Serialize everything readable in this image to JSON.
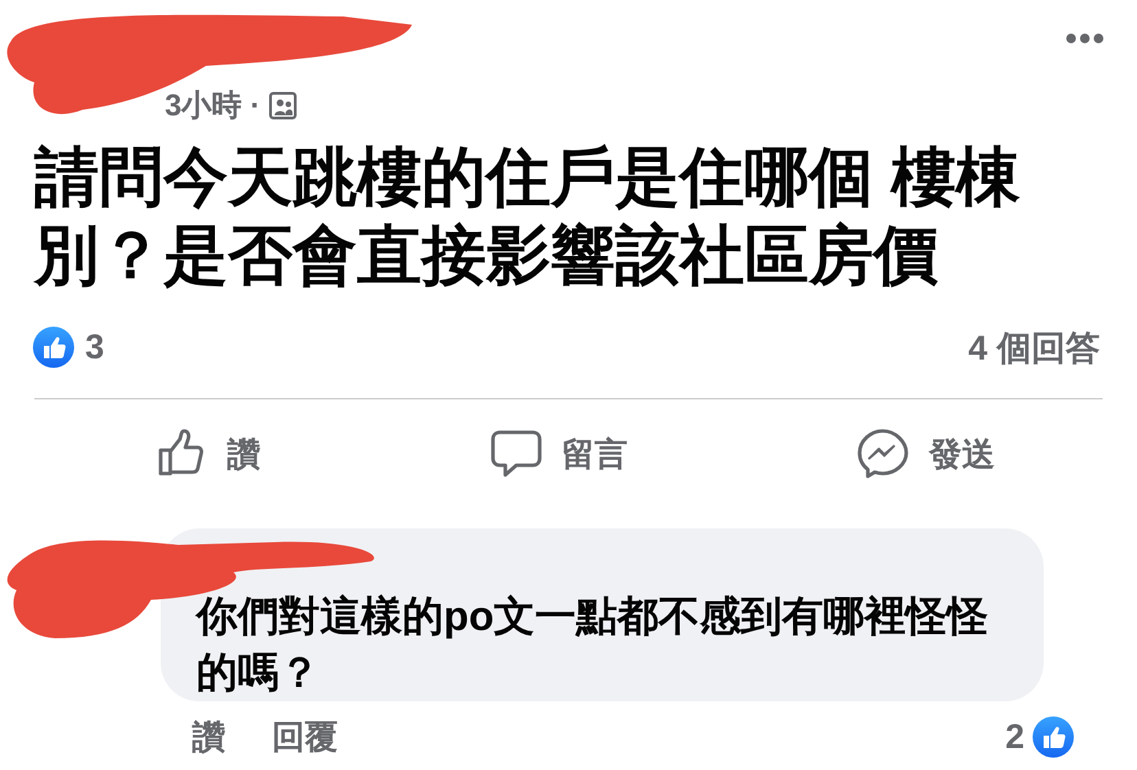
{
  "post": {
    "time": "3小時",
    "separator": "·",
    "text": "請問今天跳樓的住戶是住哪個 樓棟別？是否會直接影響該社區房價",
    "reaction_count": "3",
    "answers": "4 個回答"
  },
  "actions": [
    {
      "kind": "like",
      "label": "讚"
    },
    {
      "kind": "comment",
      "label": "留言"
    },
    {
      "kind": "send",
      "label": "發送"
    }
  ],
  "comments": [
    {
      "text": "你們對這樣的po文一點都不感到有哪裡怪怪的嗎？",
      "actions": [
        "讚",
        "回覆"
      ],
      "reaction_count": "2"
    }
  ]
}
